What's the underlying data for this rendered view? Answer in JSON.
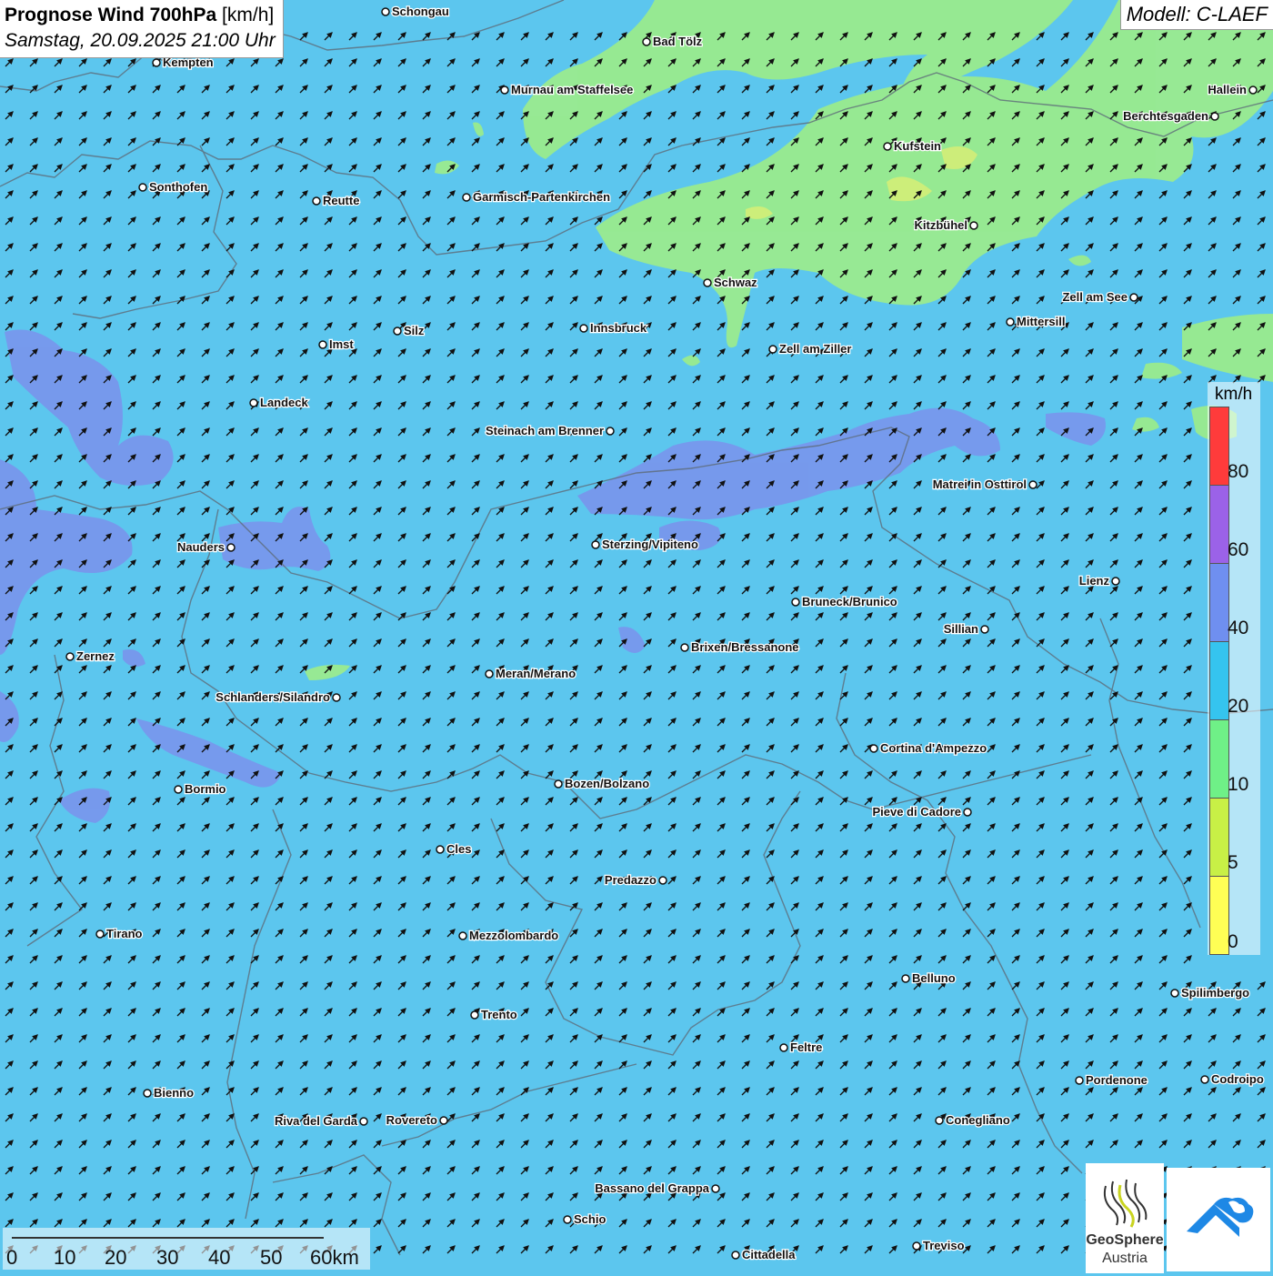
{
  "header": {
    "title": "Prognose Wind 700hPa",
    "unit": "[km/h]",
    "datetime": "Samstag, 20.09.2025 21:00 Uhr",
    "model": "Modell: C-LAEF"
  },
  "legend": {
    "unit": "km/h",
    "ticks": [
      "80",
      "60",
      "40",
      "20",
      "10",
      "5",
      "0"
    ],
    "colors": [
      "#ff3b3b",
      "#fff",
      "#9b62e8",
      "#fff",
      "#6f8ff0",
      "#fff",
      "#35c4ef",
      "#fff",
      "#6ff087",
      "#fff",
      "#c8f046",
      "#fff",
      "#ffff55"
    ]
  },
  "scale": {
    "ticks": [
      "0",
      "10",
      "20",
      "30",
      "40",
      "50",
      "60km"
    ]
  },
  "logos": {
    "geosphere_name": "GeoSphere",
    "geosphere_sub": "Austria"
  },
  "map": {
    "background_color": "#5cc6ee",
    "wind_arrow_direction": "NE",
    "cities": [
      "Schongau",
      "Bad Tölz",
      "Kempten",
      "Murnau am Staffelsee",
      "Hallein",
      "Berchtesgaden",
      "Kufstein",
      "Sonthofen",
      "Reutte",
      "Garmisch-Partenkirchen",
      "Kitzbühel",
      "Schwaz",
      "Zell am See",
      "Mittersill",
      "Innsbruck",
      "Imst",
      "Silz",
      "Zell am Ziller",
      "Landeck",
      "Steinach am Brenner",
      "Matrei in Osttirol",
      "Nauders",
      "Sterzing/Vipiteno",
      "Lienz",
      "Bruneck/Brunico",
      "Sillian",
      "Zernez",
      "Brixen/Bressanone",
      "Meran/Merano",
      "Schlanders/Silandro",
      "Cortina d'Ampezzo",
      "Bormio",
      "Bozen/Bolzano",
      "Pieve di Cadore",
      "Cles",
      "Predazzo",
      "Tirano",
      "Mezzolombardo",
      "Belluno",
      "Spilimbergo",
      "Trento",
      "Feltre",
      "Pordenone",
      "Codroipo",
      "Bienno",
      "Riva del Garda",
      "Rovereto",
      "Conegliano",
      "Bassano del Grappa",
      "Schio",
      "Treviso",
      "Cittadella"
    ]
  }
}
